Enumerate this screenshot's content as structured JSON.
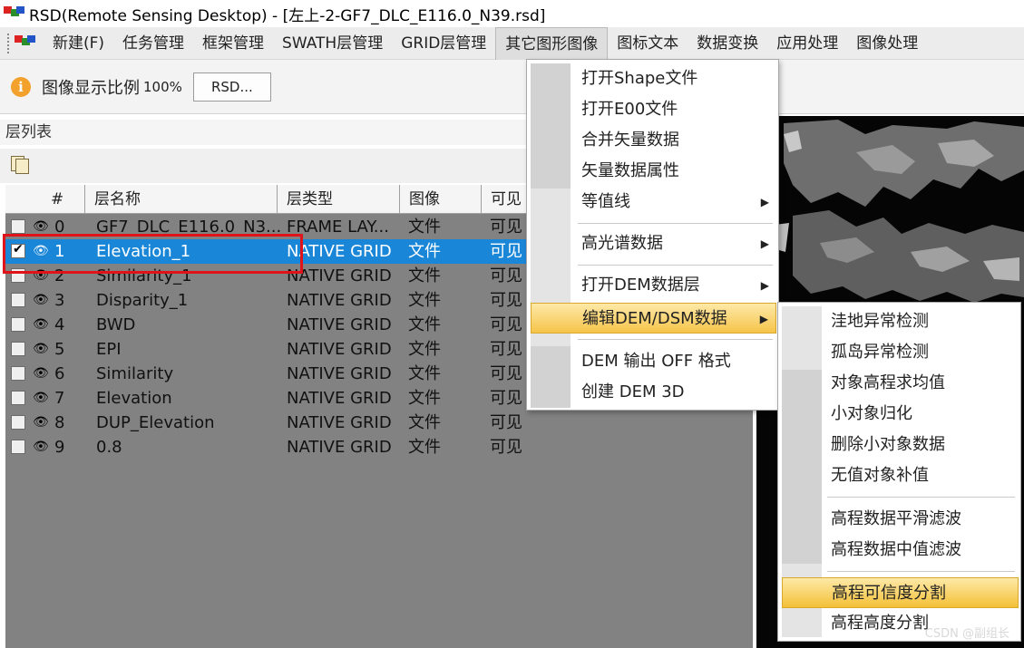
{
  "window": {
    "title": "RSD(Remote Sensing Desktop) - [左上-2-GF7_DLC_E116.0_N39.rsd]"
  },
  "menubar": {
    "items": [
      {
        "label": "新建(F)"
      },
      {
        "label": "任务管理"
      },
      {
        "label": "框架管理"
      },
      {
        "label": "SWATH层管理"
      },
      {
        "label": "GRID层管理"
      },
      {
        "label": "其它图形图像"
      },
      {
        "label": "图标文本"
      },
      {
        "label": "数据变换"
      },
      {
        "label": "应用处理"
      },
      {
        "label": "图像处理"
      }
    ],
    "open_index": 5
  },
  "toolbar": {
    "scale_label": "图像显示比例",
    "scale_value": "100%",
    "rsd_button": "RSD..."
  },
  "layer_panel": {
    "title": "层列表",
    "columns": [
      "#",
      "层名称",
      "层类型",
      "图像",
      "可见"
    ],
    "rows": [
      {
        "num": "0",
        "name": "GF7_DLC_E116.0_N3...",
        "type": "FRAME LAY...",
        "image": "文件",
        "visible": "可见",
        "checked": false,
        "selected": false
      },
      {
        "num": "1",
        "name": "Elevation_1",
        "type": "NATIVE GRID",
        "image": "文件",
        "visible": "可见",
        "checked": true,
        "selected": true
      },
      {
        "num": "2",
        "name": "Similarity_1",
        "type": "NATIVE GRID",
        "image": "文件",
        "visible": "可见",
        "checked": false,
        "selected": false
      },
      {
        "num": "3",
        "name": "Disparity_1",
        "type": "NATIVE GRID",
        "image": "文件",
        "visible": "可见",
        "checked": false,
        "selected": false
      },
      {
        "num": "4",
        "name": "BWD",
        "type": "NATIVE GRID",
        "image": "文件",
        "visible": "可见",
        "checked": false,
        "selected": false
      },
      {
        "num": "5",
        "name": "EPI",
        "type": "NATIVE GRID",
        "image": "文件",
        "visible": "可见",
        "checked": false,
        "selected": false
      },
      {
        "num": "6",
        "name": "Similarity",
        "type": "NATIVE GRID",
        "image": "文件",
        "visible": "可见",
        "checked": false,
        "selected": false
      },
      {
        "num": "7",
        "name": "Elevation",
        "type": "NATIVE GRID",
        "image": "文件",
        "visible": "可见",
        "checked": false,
        "selected": false
      },
      {
        "num": "8",
        "name": "DUP_Elevation",
        "type": "NATIVE GRID",
        "image": "文件",
        "visible": "可见",
        "checked": false,
        "selected": false
      },
      {
        "num": "9",
        "name": "0.8",
        "type": "NATIVE GRID",
        "image": "文件",
        "visible": "可见",
        "checked": false,
        "selected": false
      }
    ]
  },
  "dropdown": {
    "items": [
      {
        "label": "打开Shape文件",
        "submenu": false
      },
      {
        "label": "打开E00文件",
        "submenu": false
      },
      {
        "label": "合并矢量数据",
        "submenu": false
      },
      {
        "label": "矢量数据属性",
        "submenu": false
      },
      {
        "label": "等值线",
        "submenu": true
      },
      {
        "label": "高光谱数据",
        "submenu": true
      },
      {
        "label": "打开DEM数据层",
        "submenu": true
      },
      {
        "label": "编辑DEM/DSM数据",
        "submenu": true,
        "highlighted": true
      },
      {
        "label": "DEM 输出 OFF 格式",
        "submenu": false
      },
      {
        "label": "创建 DEM 3D",
        "submenu": false
      }
    ]
  },
  "submenu": {
    "items": [
      {
        "label": "洼地异常检测"
      },
      {
        "label": "孤岛异常检测"
      },
      {
        "label": "对象高程求均值"
      },
      {
        "label": "小对象归化"
      },
      {
        "label": "删除小对象数据"
      },
      {
        "label": "无值对象补值"
      },
      {
        "label": "高程数据平滑滤波"
      },
      {
        "label": "高程数据中值滤波"
      },
      {
        "label": "高程可信度分割",
        "highlighted": true
      },
      {
        "label": "高程高度分割"
      }
    ]
  },
  "watermark": "CSDN @副组长",
  "colors": {
    "selection": "#1a86d8",
    "highlight_box": "#e0131a",
    "menu_highlight": "#f6c44a"
  }
}
